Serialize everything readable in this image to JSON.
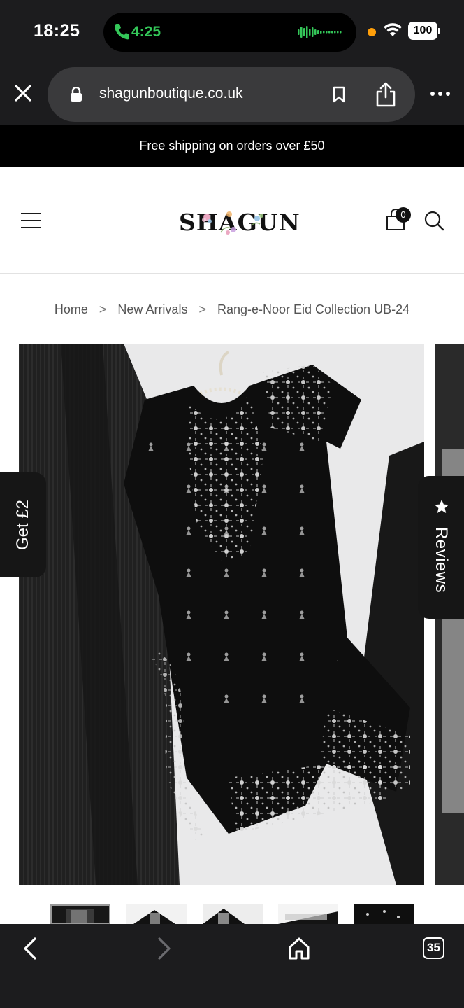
{
  "status_bar": {
    "time": "18:25",
    "call_time": "4:25",
    "battery": "100",
    "icons": [
      "phone-icon",
      "waveform-icon",
      "wifi-icon",
      "battery-icon"
    ]
  },
  "browser": {
    "url": "shagunboutique.co.uk",
    "tab_count": "35",
    "icons": [
      "close-icon",
      "lock-icon",
      "bookmark-icon",
      "share-icon",
      "more-icon",
      "back-icon",
      "forward-icon",
      "home-icon"
    ]
  },
  "announcement": "Free shipping on orders over £50",
  "header": {
    "logo_text": "SHAGUN",
    "cart_count": "0",
    "icons": [
      "menu-icon",
      "cart-icon",
      "search-icon"
    ]
  },
  "breadcrumb": {
    "items": [
      "Home",
      "New Arrivals",
      "Rang-e-Noor Eid Collection UB-24"
    ],
    "separator": ">"
  },
  "floating": {
    "get_label": "Get £2",
    "reviews_label": "Reviews"
  },
  "gallery": {
    "thumbnail_count": 5,
    "active_thumbnail": 1
  },
  "colors": {
    "announcement_bg": "#000000",
    "browser_chrome": "#1c1c1e",
    "call_green": "#34c759"
  }
}
